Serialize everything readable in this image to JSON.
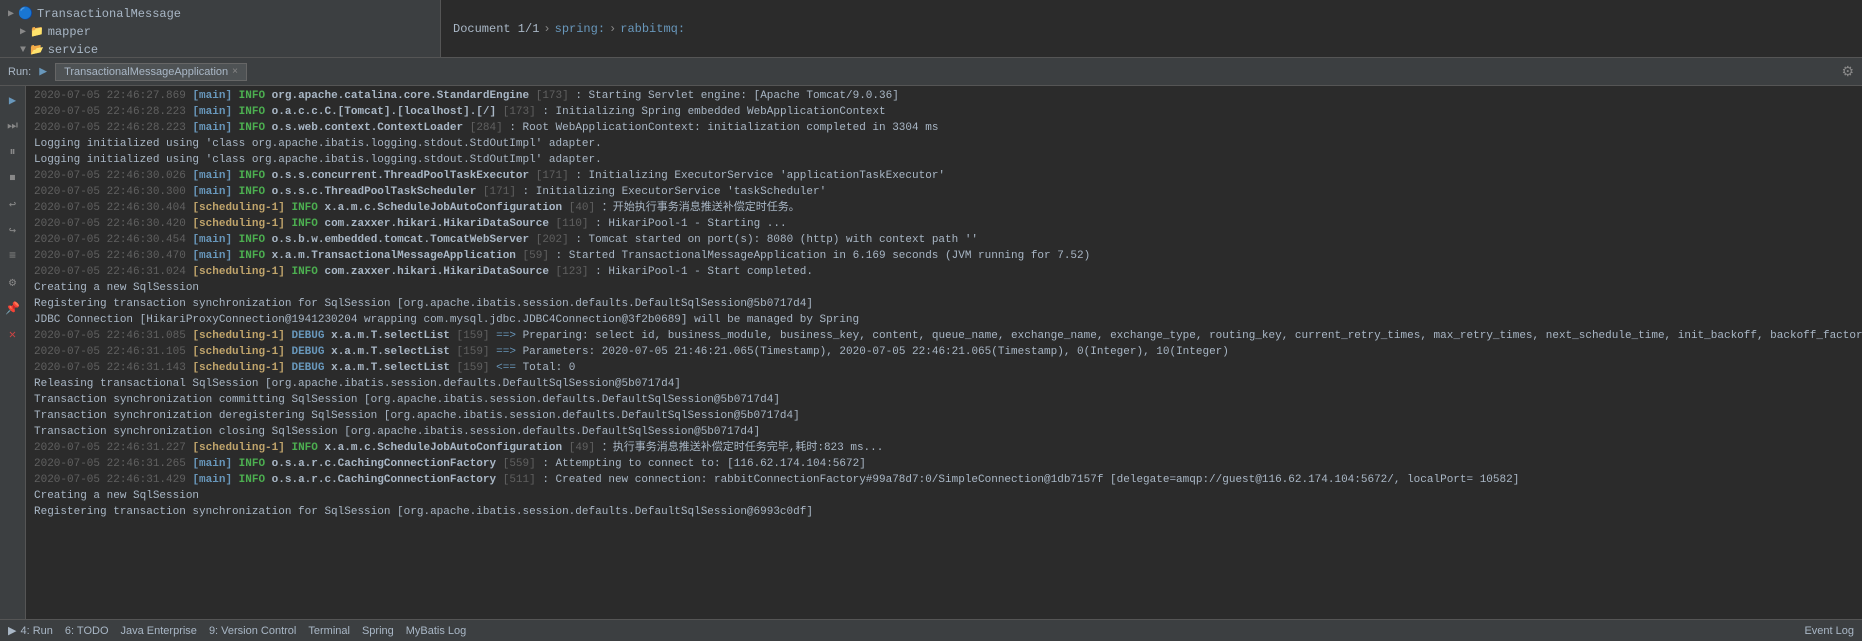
{
  "file_tree": {
    "items": [
      {
        "id": "transactional-message",
        "label": "TransactionalMessage",
        "type": "file",
        "indent": 0,
        "arrow": "▶"
      },
      {
        "id": "mapper",
        "label": "mapper",
        "type": "folder",
        "indent": 1,
        "arrow": "▶"
      },
      {
        "id": "service",
        "label": "service",
        "type": "folder",
        "indent": 1,
        "arrow": "▼",
        "expanded": true
      }
    ]
  },
  "breadcrumb": {
    "parts": [
      "Document 1/1",
      "spring:",
      "rabbitmq:"
    ]
  },
  "run_tab": {
    "label": "TransactionalMessageApplication",
    "close": "×"
  },
  "run_label": "Run:",
  "log_lines": [
    {
      "id": 1,
      "ts": "2020-07-05 22:46:27.869",
      "thread": "main",
      "level": "INFO",
      "class": "org.apache.catalina.core.StandardEngine",
      "linenum": "[173]",
      "msg": ": Starting Servlet engine: [Apache Tomcat/9.0.36]"
    },
    {
      "id": 2,
      "ts": "2020-07-05 22:46:28.223",
      "thread": "main",
      "level": "INFO",
      "class": "o.a.c.c.C.[Tomcat].[localhost].[/]",
      "linenum": "[173]",
      "msg": ": Initializing Spring embedded WebApplicationContext"
    },
    {
      "id": 3,
      "ts": "2020-07-05 22:46:28.223",
      "thread": "main",
      "level": "INFO",
      "class": "o.s.web.context.ContextLoader",
      "linenum": "[284]",
      "msg": ": Root WebApplicationContext: initialization completed in 3304 ms"
    },
    {
      "id": 4,
      "plain": "Logging initialized using 'class org.apache.ibatis.logging.stdout.StdOutImpl' adapter."
    },
    {
      "id": 5,
      "plain": "Logging initialized using 'class org.apache.ibatis.logging.stdout.StdOutImpl' adapter."
    },
    {
      "id": 6,
      "ts": "2020-07-05 22:46:30.026",
      "thread": "main",
      "level": "INFO",
      "class": "o.s.s.concurrent.ThreadPoolTaskExecutor",
      "linenum": "[171]",
      "msg": ": Initializing ExecutorService 'applicationTaskExecutor'"
    },
    {
      "id": 7,
      "ts": "2020-07-05 22:46:30.300",
      "thread": "main",
      "level": "INFO",
      "class": "o.s.s.c.ThreadPoolTaskScheduler",
      "linenum": "[171]",
      "msg": ": Initializing ExecutorService 'taskScheduler'"
    },
    {
      "id": 8,
      "ts": "2020-07-05 22:46:30.404",
      "thread": "scheduling-1",
      "level": "INFO",
      "class": "x.a.m.c.ScheduleJobAutoConfiguration",
      "linenum": "[40]",
      "msg": "：开始执行事务消息推送补偿定时任务。"
    },
    {
      "id": 9,
      "ts": "2020-07-05 22:46:30.420",
      "thread": "scheduling-1",
      "level": "INFO",
      "class": "com.zaxxer.hikari.HikariDataSource",
      "linenum": "[110]",
      "msg": ": HikariPool-1 - Starting ..."
    },
    {
      "id": 10,
      "ts": "2020-07-05 22:46:30.454",
      "thread": "main",
      "level": "INFO",
      "class": "o.s.b.w.embedded.tomcat.TomcatWebServer",
      "linenum": "[202]",
      "msg": ": Tomcat started on port(s): 8080 (http) with context path ''"
    },
    {
      "id": 11,
      "ts": "2020-07-05 22:46:30.470",
      "thread": "main",
      "level": "INFO",
      "class": "x.a.m.TransactionalMessageApplication",
      "linenum": "[59]",
      "msg": ": Started TransactionalMessageApplication in 6.169 seconds (JVM running for 7.52)"
    },
    {
      "id": 12,
      "ts": "2020-07-05 22:46:31.024",
      "thread": "scheduling-1",
      "level": "INFO",
      "class": "com.zaxxer.hikari.HikariDataSource",
      "linenum": "[123]",
      "msg": ": HikariPool-1 - Start completed."
    },
    {
      "id": 13,
      "plain": "Creating a new SqlSession"
    },
    {
      "id": 14,
      "plain": "Registering transaction synchronization for SqlSession [org.apache.ibatis.session.defaults.DefaultSqlSession@5b0717d4]"
    },
    {
      "id": 15,
      "plain": "JDBC Connection [HikariProxyConnection@1941230204 wrapping com.mysql.jdbc.JDBC4Connection@3f2b0689] will be managed by Spring"
    },
    {
      "id": 16,
      "ts": "2020-07-05 22:46:31.085",
      "thread": "scheduling-1",
      "level": "DEBUG",
      "class": "x.a.m.T.selectList",
      "linenum": "[159]",
      "msg": "==>  Preparing: select id, business_module, business_key, content, queue_name, exchange_name, exchange_type, routing_key, current_retry_times, max_retry_times, next_schedule_time, init_backoff, backoff_factor, status, create_time, update_time from transactional_message where next_schedule_time <= ? AND next_schedule_time <= ? AND status = ? AND current_retry_times < max_retry_times LIMIT ?"
    },
    {
      "id": 17,
      "ts": "2020-07-05 22:46:31.105",
      "thread": "scheduling-1",
      "level": "DEBUG",
      "class": "x.a.m.T.selectList",
      "linenum": "[159]",
      "msg": "==> Parameters: 2020-07-05 21:46:21.065(Timestamp), 2020-07-05 22:46:21.065(Timestamp), 0(Integer), 10(Integer)"
    },
    {
      "id": 18,
      "ts": "2020-07-05 22:46:31.143",
      "thread": "scheduling-1",
      "level": "DEBUG",
      "class": "x.a.m.T.selectList",
      "linenum": "[159]",
      "msg": "<==      Total: 0"
    },
    {
      "id": 19,
      "plain": "Releasing transactional SqlSession [org.apache.ibatis.session.defaults.DefaultSqlSession@5b0717d4]"
    },
    {
      "id": 20,
      "plain": "Transaction synchronization committing SqlSession [org.apache.ibatis.session.defaults.DefaultSqlSession@5b0717d4]"
    },
    {
      "id": 21,
      "plain": "Transaction synchronization deregistering SqlSession [org.apache.ibatis.session.defaults.DefaultSqlSession@5b0717d4]"
    },
    {
      "id": 22,
      "plain": "Transaction synchronization closing SqlSession [org.apache.ibatis.session.defaults.DefaultSqlSession@5b0717d4]"
    },
    {
      "id": 23,
      "ts": "2020-07-05 22:46:31.227",
      "thread": "scheduling-1",
      "level": "INFO",
      "class": "x.a.m.c.ScheduleJobAutoConfiguration",
      "linenum": "[49]",
      "msg": "：执行事务消息推送补偿定时任务完毕,耗时:823 ms..."
    },
    {
      "id": 24,
      "ts": "2020-07-05 22:46:31.265",
      "thread": "main",
      "level": "INFO",
      "class": "o.s.a.r.c.CachingConnectionFactory",
      "linenum": "[559]",
      "msg": ": Attempting to connect to: [116.62.174.104:5672]"
    },
    {
      "id": 25,
      "ts": "2020-07-05 22:46:31.429",
      "thread": "main",
      "level": "INFO",
      "class": "o.s.a.r.c.CachingConnectionFactory",
      "linenum": "[511]",
      "msg": ": Created new connection: rabbitConnectionFactory#99a78d7:0/SimpleConnection@1db7157f [delegate=amqp://guest@116.62.174.104:5672/, localPort= 10582]"
    },
    {
      "id": 26,
      "plain": "Creating a new SqlSession"
    },
    {
      "id": 27,
      "plain": "Registering transaction synchronization for SqlSession [org.apache.ibatis.session.defaults.DefaultSqlSession@6993c0df]"
    }
  ],
  "status_bar": {
    "run_icon": "▶",
    "run_label": "4: Run",
    "todo_label": "6: TODO",
    "java_enterprise": "Java Enterprise",
    "version_control": "9: Version Control",
    "terminal": "Terminal",
    "spring": "Spring",
    "mybatis": "MyBatis Log",
    "event_log": "Event Log"
  },
  "sidebar_icons": [
    "▶",
    "▶",
    "⏸",
    "⏹",
    "↩",
    "↪",
    "📋",
    "🔧",
    "✕"
  ]
}
